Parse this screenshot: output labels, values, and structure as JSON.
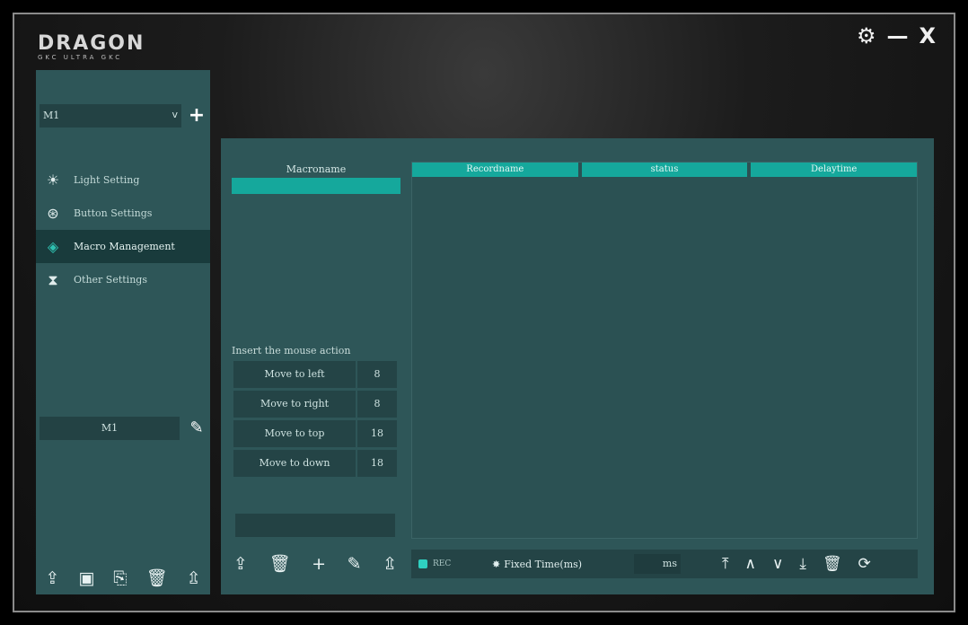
{
  "app": {
    "brand": "DRAGON",
    "brand_sub": "GKC ULTRA GKC"
  },
  "window_controls": {
    "settings_icon": "⚙",
    "minimize_icon": "—",
    "close_icon": "X"
  },
  "sidebar": {
    "profile_value": "M1",
    "profile_chevron": "v",
    "profile_add": "+",
    "nav": [
      {
        "label": "Light Setting",
        "icon": "☀",
        "active": false
      },
      {
        "label": "Button Settings",
        "icon": "⊛",
        "active": false
      },
      {
        "label": "Macro Management",
        "icon": "◈",
        "active": true
      },
      {
        "label": "Other Settings",
        "icon": "⧗",
        "active": false
      }
    ],
    "macro_name": "M1",
    "edit_icon": "✎",
    "tools": [
      "⇪",
      "▣",
      "⎘",
      "🗑",
      "⇫"
    ]
  },
  "macro_list": {
    "header": "Macroname"
  },
  "insert": {
    "label": "Insert the mouse action",
    "moves": [
      {
        "name": "Move to left",
        "value": "8"
      },
      {
        "name": "Move to right",
        "value": "8"
      },
      {
        "name": "Move to top",
        "value": "18"
      },
      {
        "name": "Move to down",
        "value": "18"
      }
    ],
    "tools": [
      "⇪",
      "🗑",
      "+",
      "✎",
      "⇫"
    ]
  },
  "table": {
    "columns": [
      "Recordname",
      "status",
      "Delaytime"
    ]
  },
  "bottom_bar": {
    "dot_label": "REC",
    "fixed_label": "Fixed Time(ms)",
    "star": "✸",
    "number": "ms",
    "tools": [
      "⤒",
      "∧",
      "∨",
      "⤓",
      "🗑",
      "⟳"
    ]
  }
}
